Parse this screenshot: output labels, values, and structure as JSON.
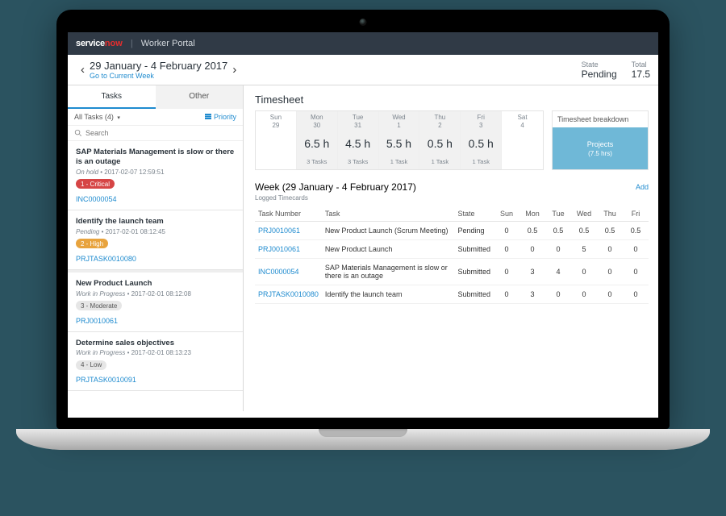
{
  "brand": {
    "svc": "service",
    "now": "now",
    "portal": "Worker Portal"
  },
  "header": {
    "range": "29 January - 4 February 2017",
    "go_current": "Go to Current Week",
    "state_label": "State",
    "state_value": "Pending",
    "total_label": "Total",
    "total_value": "17.5"
  },
  "left": {
    "tab_tasks": "Tasks",
    "tab_other": "Other",
    "filter": "All Tasks (4)",
    "priority": "Priority",
    "search_placeholder": "Search",
    "tasks": [
      {
        "title": "SAP Materials Management is slow or there is an outage",
        "status": "On hold",
        "ts": "2017-02-07 12:59:51",
        "badge": "1 - Critical",
        "badge_class": "crit",
        "link": "INC0000054"
      },
      {
        "title": "Identify the launch team",
        "status": "Pending",
        "ts": "2017-02-01 08:12:45",
        "badge": "2 - High",
        "badge_class": "high",
        "link": "PRJTASK0010080"
      },
      {
        "title": "New Product Launch",
        "status": "Work in Progress",
        "ts": "2017-02-01 08:12:08",
        "badge": "3 - Moderate",
        "badge_class": "mod",
        "link": "PRJ0010061"
      },
      {
        "title": "Determine sales objectives",
        "status": "Work in Progress",
        "ts": "2017-02-01 08:13:23",
        "badge": "4 - Low",
        "badge_class": "low",
        "link": "PRJTASK0010091"
      }
    ]
  },
  "timesheet": {
    "title": "Timesheet",
    "days": [
      {
        "name": "Sun",
        "date": "29",
        "hours": "",
        "tasks": ""
      },
      {
        "name": "Mon",
        "date": "30",
        "hours": "6.5 h",
        "tasks": "3 Tasks"
      },
      {
        "name": "Tue",
        "date": "31",
        "hours": "4.5 h",
        "tasks": "3 Tasks"
      },
      {
        "name": "Wed",
        "date": "1",
        "hours": "5.5 h",
        "tasks": "1 Task"
      },
      {
        "name": "Thu",
        "date": "2",
        "hours": "0.5 h",
        "tasks": "1 Task"
      },
      {
        "name": "Fri",
        "date": "3",
        "hours": "0.5 h",
        "tasks": "1 Task"
      },
      {
        "name": "Sat",
        "date": "4",
        "hours": "",
        "tasks": ""
      }
    ],
    "breakdown_title": "Timesheet breakdown",
    "breakdown_name": "Projects",
    "breakdown_hours": "(7.5 hrs)"
  },
  "week": {
    "title": "Week (29 January - 4 February 2017)",
    "sub": "Logged Timecards",
    "add": "Add",
    "columns": [
      "Task Number",
      "Task",
      "State",
      "Sun",
      "Mon",
      "Tue",
      "Wed",
      "Thu",
      "Fri"
    ],
    "rows": [
      {
        "num": "PRJ0010061",
        "task": "New Product Launch (Scrum Meeting)",
        "state": "Pending",
        "d": [
          "0",
          "0.5",
          "0.5",
          "0.5",
          "0.5",
          "0.5"
        ]
      },
      {
        "num": "PRJ0010061",
        "task": "New Product Launch",
        "state": "Submitted",
        "d": [
          "0",
          "0",
          "0",
          "5",
          "0",
          "0"
        ]
      },
      {
        "num": "INC0000054",
        "task": "SAP Materials Management is slow or there is an outage",
        "state": "Submitted",
        "d": [
          "0",
          "3",
          "4",
          "0",
          "0",
          "0"
        ]
      },
      {
        "num": "PRJTASK0010080",
        "task": "Identify the launch team",
        "state": "Submitted",
        "d": [
          "0",
          "3",
          "0",
          "0",
          "0",
          "0"
        ]
      }
    ]
  }
}
